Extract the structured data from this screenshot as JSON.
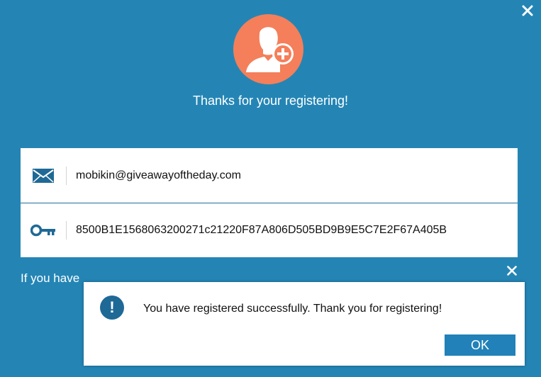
{
  "window": {
    "close_icon": "close-icon",
    "heading": "Thanks for your registering!",
    "avatar_icon": "add-user-icon",
    "accent_color": "#f47f5a",
    "background_color": "#2485b5"
  },
  "registration": {
    "email_icon": "envelope-icon",
    "email": "mobikin@giveawayoftheday.com",
    "key_icon": "key-icon",
    "license_key": "8500B1E1568063200271c21220F87A806D505BD9B9E5C7E2F67A405B"
  },
  "background_text": "If you have",
  "dialog": {
    "close_icon": "close-icon",
    "alert_icon": "exclamation-icon",
    "alert_glyph": "!",
    "message": "You have registered successfully. Thank you for registering!",
    "ok_label": "OK"
  }
}
